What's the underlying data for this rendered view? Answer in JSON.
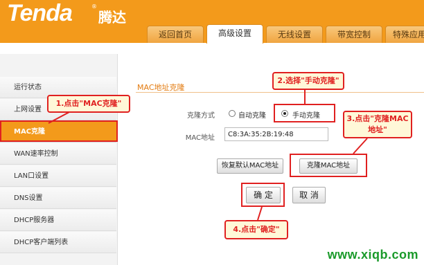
{
  "brand": {
    "logo": "Tenda",
    "logo_cn": "腾达",
    "reg": "®"
  },
  "tabs": [
    {
      "label": "返回首页"
    },
    {
      "label": "高级设置"
    },
    {
      "label": "无线设置"
    },
    {
      "label": "带宽控制"
    },
    {
      "label": "特殊应用"
    }
  ],
  "sidebar": {
    "items": [
      {
        "label": "运行状态"
      },
      {
        "label": "上网设置"
      },
      {
        "label": "MAC克隆"
      },
      {
        "label": "WAN速率控制"
      },
      {
        "label": "LAN口设置"
      },
      {
        "label": "DNS设置"
      },
      {
        "label": "DHCP服务器"
      },
      {
        "label": "DHCP客户端列表"
      }
    ]
  },
  "main": {
    "section_title": "MAC地址克隆",
    "clone_mode_label": "克隆方式",
    "auto_clone_label": "自动克隆",
    "manual_clone_label": "手动克隆",
    "clone_mode_selected": "手动克隆",
    "mac_label": "MAC地址",
    "mac_value": "C8:3A:35:2B:19:48",
    "restore_default_label": "恢复默认MAC地址",
    "clone_mac_label": "克隆MAC地址",
    "ok_label": "确 定",
    "cancel_label": "取 消"
  },
  "annotations": {
    "step1": "1.点击\"MAC克隆\"",
    "step2": "2.选择\"手动克隆\"",
    "step3": "3.点击\"克隆MAC地址\"",
    "step4": "4.点击\"确定\""
  },
  "watermark": "www.xiqb.com",
  "colors": {
    "brand_orange": "#f39a1b",
    "highlight_red": "#e02020",
    "watermark_green": "#1a9a2a"
  }
}
